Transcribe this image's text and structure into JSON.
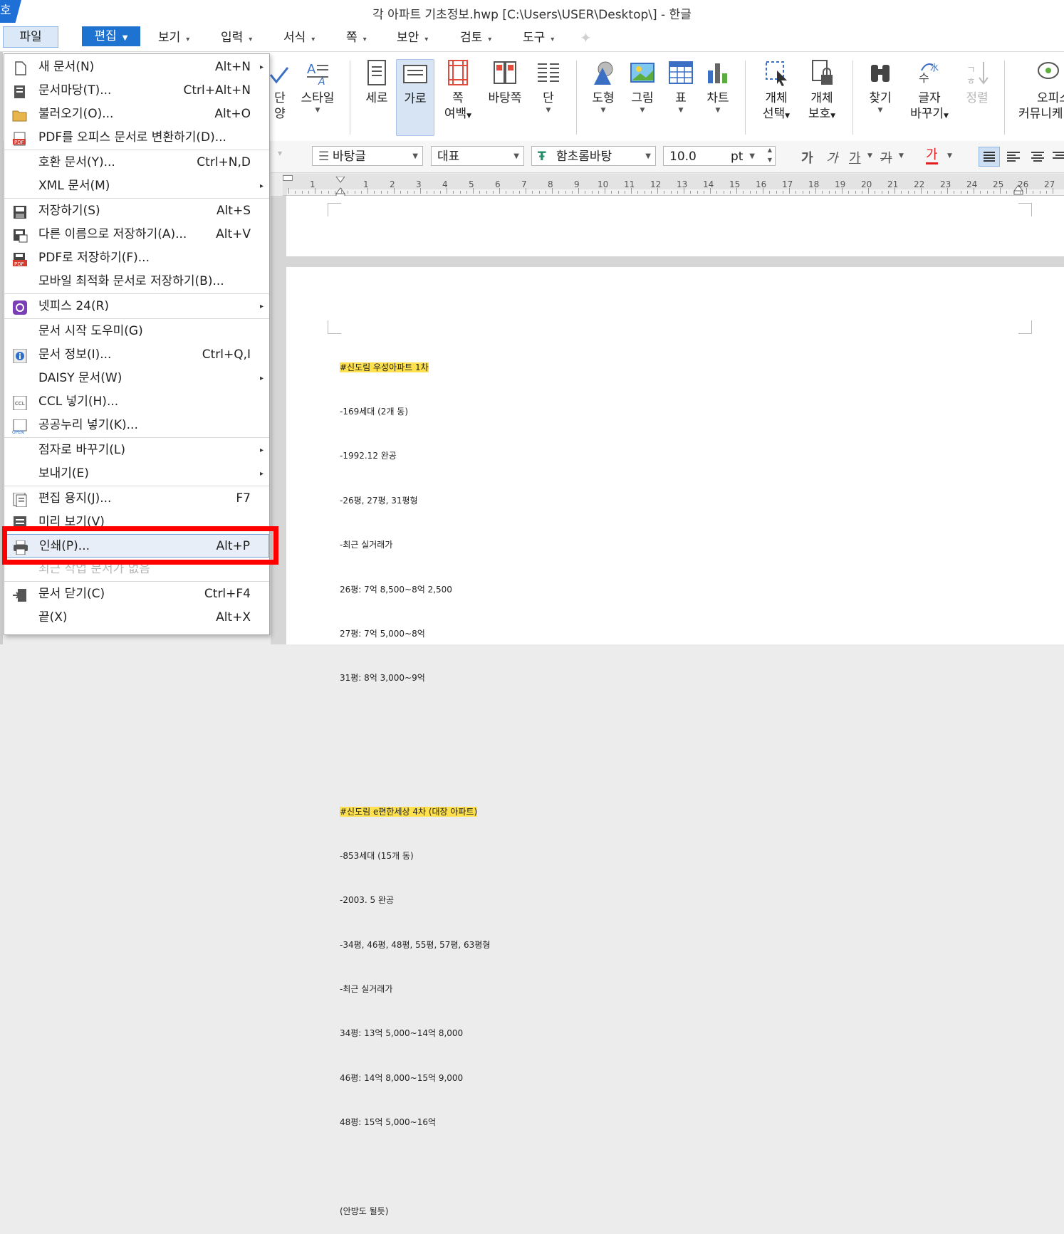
{
  "window": {
    "app_icon": "호",
    "title": "각 아파트 기초정보.hwp [C:\\Users\\USER\\Desktop\\] - 한글"
  },
  "menubar": {
    "items": [
      {
        "label": "파일"
      },
      {
        "label": "편집"
      },
      {
        "label": "보기"
      },
      {
        "label": "입력"
      },
      {
        "label": "서식"
      },
      {
        "label": "쪽"
      },
      {
        "label": "보안"
      },
      {
        "label": "검토"
      },
      {
        "label": "도구"
      }
    ]
  },
  "ribbon": {
    "buttons": [
      {
        "label": "단",
        "label2": "양"
      },
      {
        "label": "스타일"
      },
      {
        "label": "세로"
      },
      {
        "label": "가로"
      },
      {
        "label": "쪽",
        "label2": "여백"
      },
      {
        "label": "바탕쪽"
      },
      {
        "label": "단"
      },
      {
        "label": "도형"
      },
      {
        "label": "그림"
      },
      {
        "label": "표"
      },
      {
        "label": "차트"
      },
      {
        "label": "개체",
        "label2": "선택"
      },
      {
        "label": "개체",
        "label2": "보호"
      },
      {
        "label": "찾기"
      },
      {
        "label": "글자",
        "label2": "바꾸기"
      },
      {
        "label": "정렬"
      },
      {
        "label": "오피스",
        "label2": "커뮤니케"
      }
    ]
  },
  "formatbar": {
    "style": "바탕글",
    "lang": "대표",
    "font": "함초롬바탕",
    "size": "10.0",
    "unit": "pt",
    "bold": "가",
    "italic": "가",
    "underline": "가",
    "strike": "가",
    "color": "가"
  },
  "ruler": {
    "numbers": [
      "1",
      "1",
      "2",
      "3",
      "4",
      "5",
      "6",
      "7",
      "8",
      "9",
      "10",
      "11",
      "12",
      "13",
      "14",
      "15",
      "16",
      "17",
      "18",
      "19",
      "20",
      "21",
      "22",
      "23",
      "24",
      "25",
      "26",
      "27"
    ]
  },
  "document": {
    "lines": [
      {
        "text": "#신도림 우성아파트 1차",
        "highlight": true
      },
      {
        "text": "-169세대 (2개 동)"
      },
      {
        "text": "-1992.12 완공"
      },
      {
        "text": "-26평, 27평, 31평형"
      },
      {
        "text": "-최근 실거래가"
      },
      {
        "text": "26평: 7억 8,500~8억 2,500"
      },
      {
        "text": "27평: 7억 5,000~8억"
      },
      {
        "text": "31평: 8억 3,000~9억"
      },
      {
        "text": ""
      },
      {
        "text": ""
      },
      {
        "text": "#신도림 e편한세상 4차 (대장 아파트)",
        "highlight": true
      },
      {
        "text": "-853세대 (15개 동)"
      },
      {
        "text": "-2003. 5 완공"
      },
      {
        "text": "-34평, 46평, 48평, 55평, 57평, 63평형"
      },
      {
        "text": "-최근 실거래가"
      },
      {
        "text": "34평: 13억 5,000~14억 8,000"
      },
      {
        "text": "46평: 14억 8,000~15억 9,000"
      },
      {
        "text": "48평: 15억 5,000~16억"
      },
      {
        "text": ""
      },
      {
        "text": "(안방도 될듯)"
      }
    ]
  },
  "file_menu": {
    "items": [
      {
        "icon": "new-document-icon",
        "label": "새 문서(N)",
        "key": "Alt+N",
        "sub": true
      },
      {
        "icon": "template-icon",
        "label": "문서마당(T)...",
        "key": "Ctrl+Alt+N"
      },
      {
        "icon": "open-folder-icon",
        "label": "불러오기(O)...",
        "key": "Alt+O"
      },
      {
        "icon": "pdf-convert-icon",
        "label": "PDF를 오피스 문서로 변환하기(D)...",
        "key": ""
      },
      {
        "sep": true
      },
      {
        "icon": "",
        "label": "호환 문서(Y)...",
        "key": "Ctrl+N,D"
      },
      {
        "icon": "",
        "label": "XML 문서(M)",
        "key": "",
        "sub": true
      },
      {
        "sep": true
      },
      {
        "icon": "save-icon",
        "label": "저장하기(S)",
        "key": "Alt+S"
      },
      {
        "icon": "save-as-icon",
        "label": "다른 이름으로 저장하기(A)...",
        "key": "Alt+V"
      },
      {
        "icon": "save-pdf-icon",
        "label": "PDF로 저장하기(F)...",
        "key": ""
      },
      {
        "icon": "",
        "label": "모바일 최적화 문서로 저장하기(B)...",
        "key": ""
      },
      {
        "sep": true
      },
      {
        "icon": "netffice-icon",
        "label": "넷피스 24(R)",
        "key": "",
        "sub": true
      },
      {
        "sep": true
      },
      {
        "icon": "",
        "label": "문서 시작 도우미(G)",
        "key": ""
      },
      {
        "icon": "info-icon",
        "label": "문서 정보(I)...",
        "key": "Ctrl+Q,I"
      },
      {
        "icon": "",
        "label": "DAISY 문서(W)",
        "key": "",
        "sub": true
      },
      {
        "icon": "ccl-icon",
        "label": "CCL 넣기(H)...",
        "key": ""
      },
      {
        "icon": "open-license-icon",
        "label": "공공누리 넣기(K)...",
        "key": ""
      },
      {
        "sep": true
      },
      {
        "icon": "",
        "label": "점자로 바꾸기(L)",
        "key": "",
        "sub": true
      },
      {
        "icon": "",
        "label": "보내기(E)",
        "key": "",
        "sub": true
      },
      {
        "sep": true
      },
      {
        "icon": "page-setup-icon",
        "label": "편집 용지(J)...",
        "key": "F7"
      },
      {
        "icon": "preview-icon",
        "label": "미리 보기(V)",
        "key": ""
      },
      {
        "icon": "printer-icon",
        "label": "인쇄(P)...",
        "key": "Alt+P",
        "selected": true
      },
      {
        "icon": "",
        "label": "최근 작업 문서가 없음",
        "key": "",
        "disabled": true
      },
      {
        "sep": true
      },
      {
        "icon": "close-document-icon",
        "label": "문서 닫기(C)",
        "key": "Ctrl+F4"
      },
      {
        "icon": "",
        "label": "끝(X)",
        "key": "Alt+X"
      }
    ]
  },
  "colors": {
    "accent": "#1f73d0",
    "highlight_text": "#ffe14d",
    "annotation_box": "#ff0000"
  }
}
